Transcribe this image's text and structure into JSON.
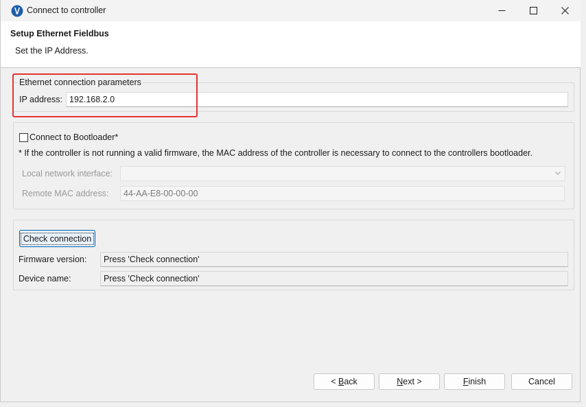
{
  "window": {
    "title": "Connect to controller"
  },
  "header": {
    "title": "Setup Ethernet Fieldbus",
    "subtitle": "Set the IP Address."
  },
  "ethernet_group": {
    "legend": "Ethernet connection parameters",
    "ip_label": "IP address:",
    "ip_value": "192.168.2.0"
  },
  "bootloader_group": {
    "checkbox_label": "Connect to Bootloader*",
    "checked": false,
    "note": "* If the controller is not running a valid firmware, the MAC address of the controller is necessary to connect to the controllers bootloader.",
    "local_iface_label": "Local network interface:",
    "local_iface_value": "",
    "remote_mac_label": "Remote MAC address:",
    "remote_mac_value": "44-AA-E8-00-00-00"
  },
  "check_group": {
    "check_button": "Check connection",
    "firmware_label": "Firmware version:",
    "firmware_value": "Press 'Check connection'",
    "device_label": "Device name:",
    "device_value": "Press 'Check connection'"
  },
  "footer": {
    "back_prefix": "< ",
    "back_mnemonic": "B",
    "back_rest": "ack",
    "next_mnemonic": "N",
    "next_rest": "ext >",
    "finish_mnemonic": "F",
    "finish_rest": "inish",
    "cancel": "Cancel"
  },
  "colors": {
    "highlight": "#e53333",
    "app_icon": "#1f5fa8"
  }
}
